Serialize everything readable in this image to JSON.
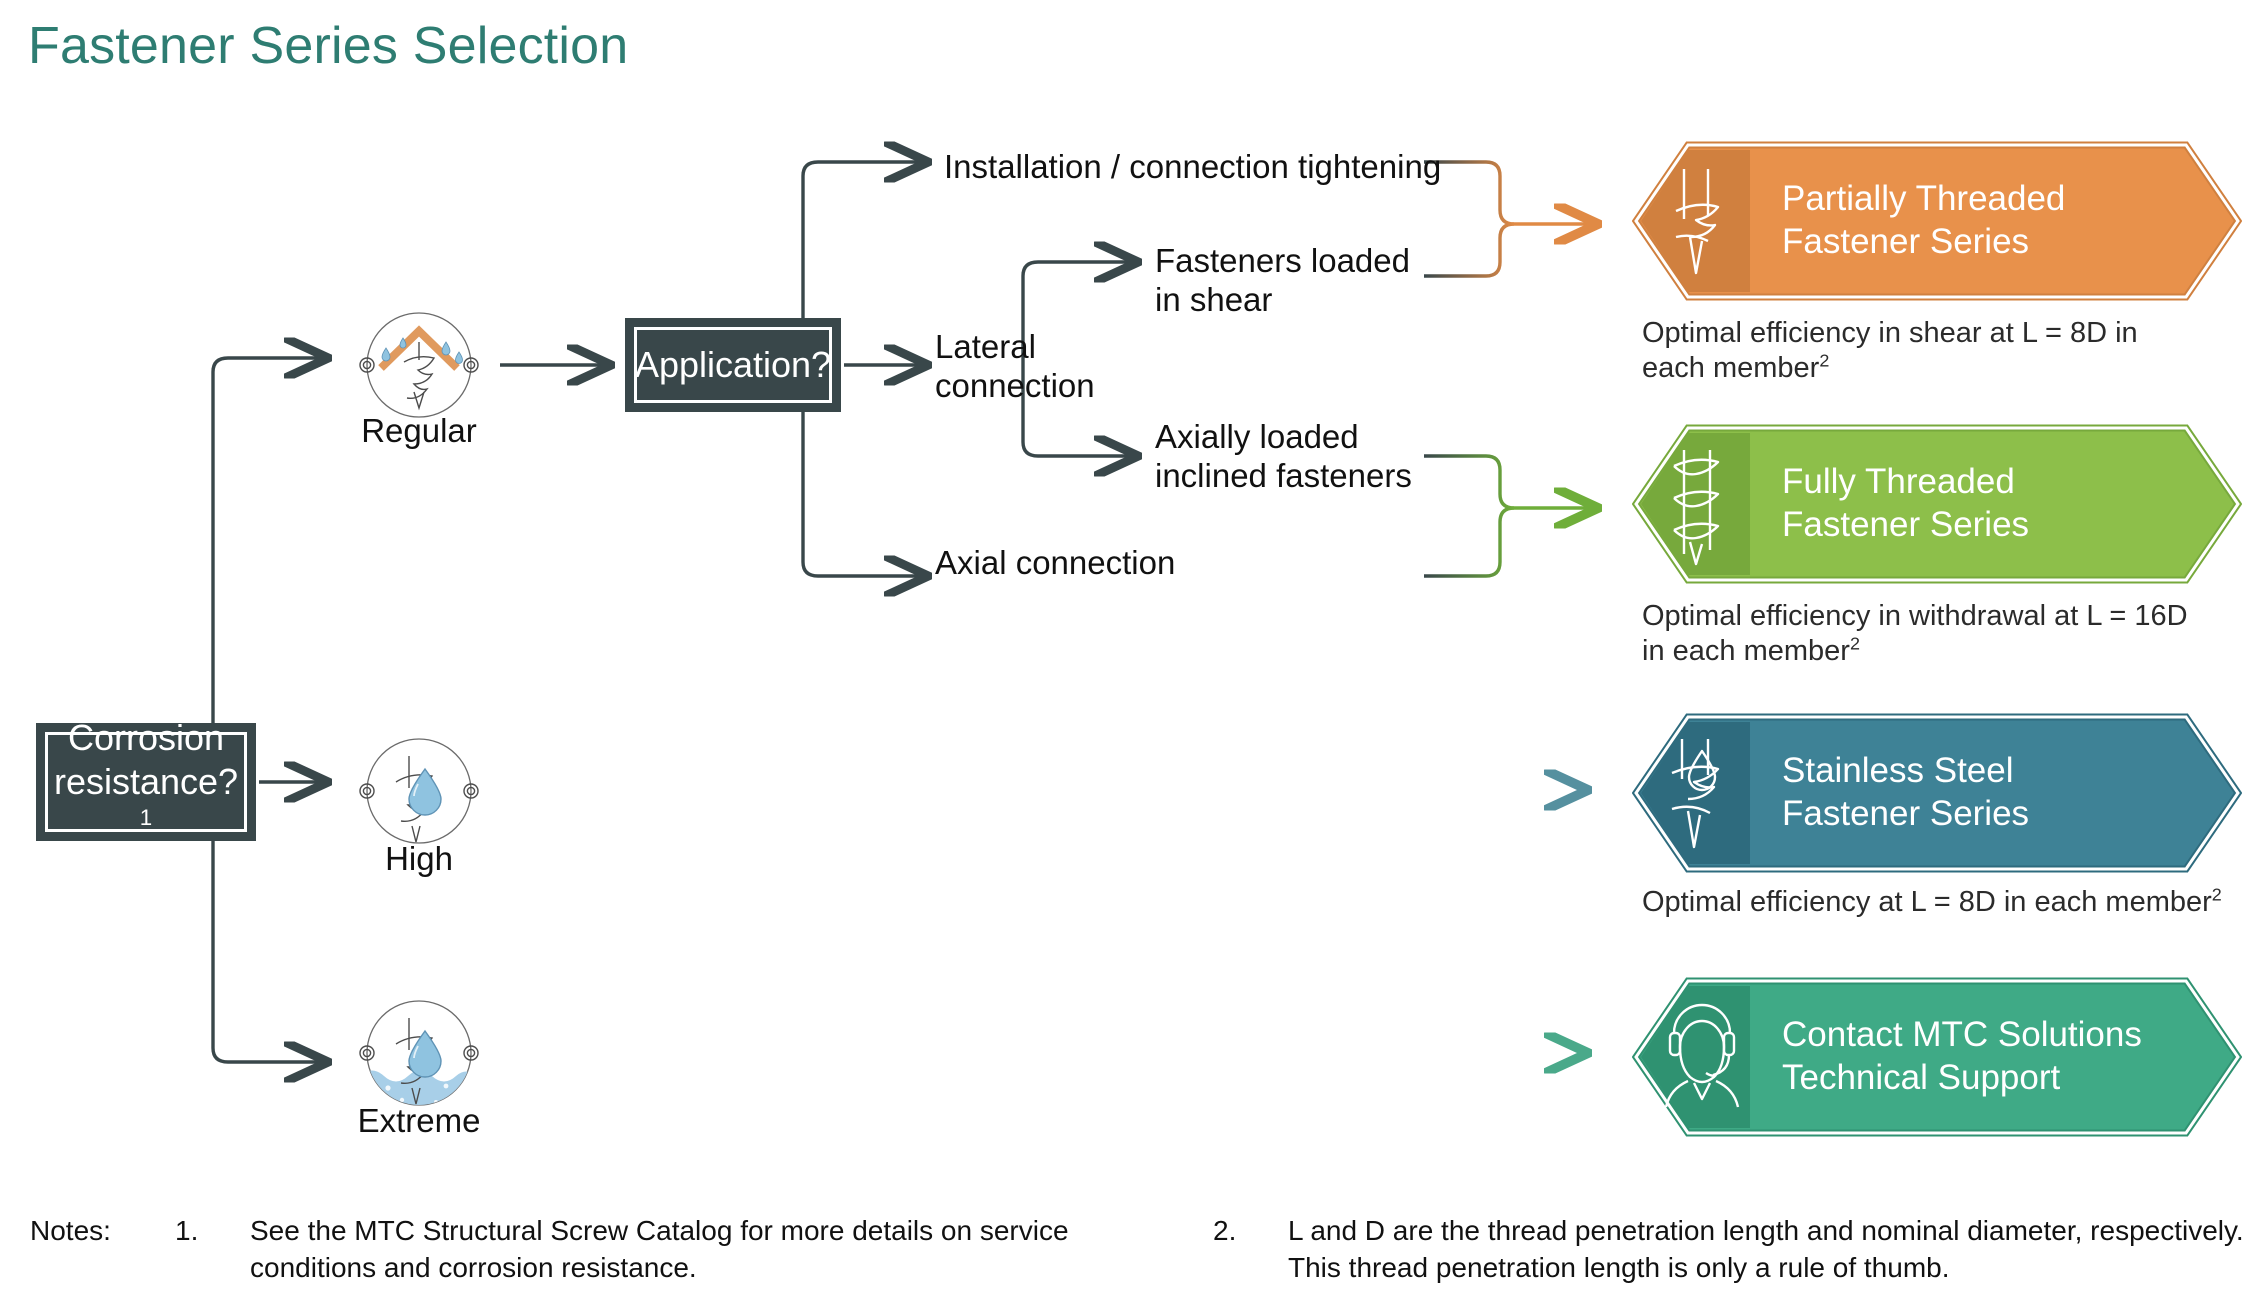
{
  "page": {
    "title": "Fastener Series Selection",
    "title_color": "#2e7d72",
    "background": "#ffffff"
  },
  "decisions": [
    {
      "id": "corrosion",
      "label_line1": "Corrosion",
      "label_line2": "resistance?",
      "footnote": "1",
      "fill": "#39474a",
      "text_color": "#ffffff"
    },
    {
      "id": "application",
      "label_line1": "Application?",
      "label_line2": "",
      "footnote": "",
      "fill": "#39474a",
      "text_color": "#ffffff"
    }
  ],
  "conditions": [
    {
      "id": "regular",
      "label": "Regular",
      "icon": "roof-screw-rain-icon"
    },
    {
      "id": "high",
      "label": "High",
      "icon": "screw-waterdrop-icon"
    },
    {
      "id": "extreme",
      "label": "Extreme",
      "icon": "screw-submerged-water-icon"
    }
  ],
  "paths": {
    "installation": "Installation / connection tightening",
    "shear": "Fasteners loaded\nin shear",
    "lateral": "Lateral\nconnection",
    "axial_inclined": "Axially loaded\ninclined fasteners",
    "axial": "Axial connection"
  },
  "results": [
    {
      "id": "partially-threaded",
      "title_line1": "Partially Threaded",
      "title_line2": "Fastener Series",
      "note": "Optimal efficiency in shear at L = 8D in\neach member",
      "note_sup": "2",
      "body_color": "#e8914b",
      "icon_color": "#d0803f",
      "border_color": "#d0803f",
      "arrow_color": "#e08a45",
      "icon": "partially-threaded-screw-icon"
    },
    {
      "id": "fully-threaded",
      "title_line1": "Fully Threaded",
      "title_line2": "Fastener Series",
      "note": "Optimal efficiency in withdrawal at L = 16D\nin each member",
      "note_sup": "2",
      "body_color": "#8dbf4a",
      "icon_color": "#77a93c",
      "border_color": "#77a93c",
      "arrow_color": "#6fae3a",
      "icon": "fully-threaded-screw-icon"
    },
    {
      "id": "stainless-steel",
      "title_line1": "Stainless Steel",
      "title_line2": "Fastener Series",
      "note": "Optimal efficiency at L = 8D in each member",
      "note_sup": "2",
      "body_color": "#3e8296",
      "icon_color": "#2e6b7e",
      "border_color": "#2e6b7e",
      "arrow_color": "#55909f",
      "icon": "stainless-screw-drop-icon"
    },
    {
      "id": "contact-support",
      "title_line1": "Contact MTC Solutions",
      "title_line2": "Technical Support",
      "note": "",
      "note_sup": "",
      "body_color": "#3faa86",
      "icon_color": "#2f9271",
      "border_color": "#2f9271",
      "arrow_color": "#4aa98a",
      "icon": "headset-support-icon"
    }
  ],
  "notes": {
    "label": "Notes:",
    "items": [
      {
        "number": "1.",
        "text": "See the MTC Structural Screw Catalog for more details on service conditions and corrosion resistance."
      },
      {
        "number": "2.",
        "text": "L and D are the thread penetration length and nominal diameter, respectively. This thread penetration length is only a rule of thumb."
      }
    ]
  },
  "colors": {
    "line": "#39474a",
    "text": "#111111",
    "rain_blue": "#8fc3e0",
    "roof_orange": "#e09a5e"
  }
}
